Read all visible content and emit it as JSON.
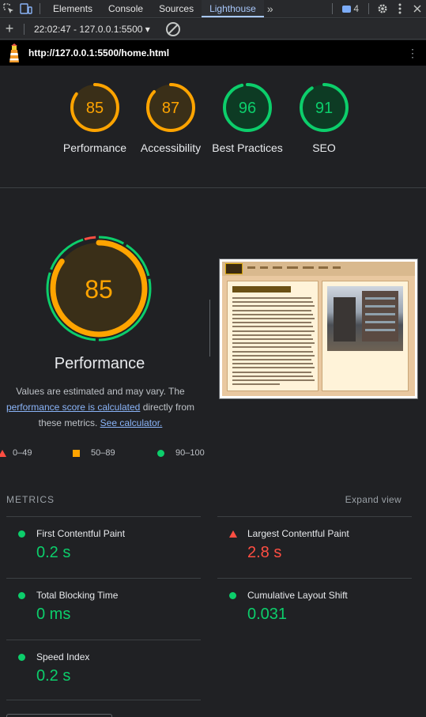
{
  "devtools": {
    "tabs": [
      "Elements",
      "Console",
      "Sources",
      "Lighthouse"
    ],
    "active_tab": "Lighthouse",
    "more_tabs": "»",
    "issues_count": "4"
  },
  "toolbar": {
    "report_select": "22:02:47 - 127.0.0.1:5500 ▾"
  },
  "url": "http://127.0.0.1:5500/home.html",
  "gauges": [
    {
      "score": "85",
      "label": "Performance",
      "value": 85,
      "color": "#ffa400"
    },
    {
      "score": "87",
      "label": "Accessibility",
      "value": 87,
      "color": "#ffa400"
    },
    {
      "score": "96",
      "label": "Best Practices",
      "value": 96,
      "color": "#0cce6b"
    },
    {
      "score": "91",
      "label": "SEO",
      "value": 91,
      "color": "#0cce6b"
    }
  ],
  "performance": {
    "score": "85",
    "value": 85,
    "title": "Performance",
    "desc_1": "Values are estimated and may vary. The ",
    "desc_link": "performance score is calculated",
    "desc_2": " directly from these metrics. ",
    "calc_link": "See calculator."
  },
  "legend": {
    "fail": "0–49",
    "average": "50–89",
    "pass": "90–100"
  },
  "metrics": {
    "heading": "METRICS",
    "expand": "Expand view",
    "items": [
      {
        "name": "First Contentful Paint",
        "value": "0.2 s",
        "status": "pass"
      },
      {
        "name": "Largest Contentful Paint",
        "value": "2.8 s",
        "status": "fail"
      },
      {
        "name": "Total Blocking Time",
        "value": "0 ms",
        "status": "pass"
      },
      {
        "name": "Cumulative Layout Shift",
        "value": "0.031",
        "status": "pass"
      },
      {
        "name": "Speed Index",
        "value": "0.2 s",
        "status": "pass"
      }
    ]
  },
  "colors": {
    "pass": "#0cce6b",
    "average": "#ffa400",
    "fail": "#ff4e42"
  }
}
